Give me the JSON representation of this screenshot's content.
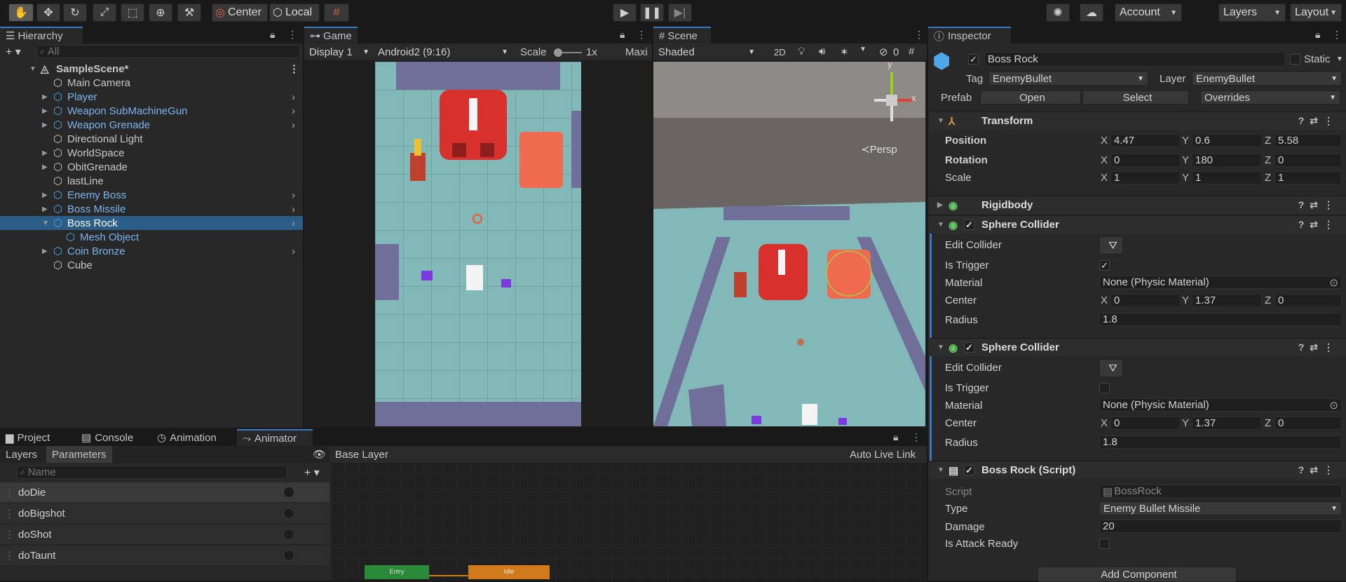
{
  "toolbar": {
    "tools": [
      "hand-tool",
      "move-tool",
      "rotate-tool",
      "scale-tool",
      "rect-tool",
      "transform-tool",
      "custom-tool"
    ],
    "pivot_label": "Center",
    "space_label": "Local",
    "account_label": "Account",
    "layers_label": "Layers",
    "layout_label": "Layout"
  },
  "hierarchy": {
    "tab": "Hierarchy",
    "search_placeholder": "All",
    "scene": "SampleScene*",
    "items": [
      {
        "label": "Main Camera",
        "prefab": false
      },
      {
        "label": "Player",
        "prefab": true
      },
      {
        "label": "Weapon SubMachineGun",
        "prefab": true
      },
      {
        "label": "Weapon Grenade",
        "prefab": true
      },
      {
        "label": "Directional Light",
        "prefab": false
      },
      {
        "label": "WorldSpace",
        "prefab": false
      },
      {
        "label": "ObitGrenade",
        "prefab": false
      },
      {
        "label": "lastLine",
        "prefab": false
      },
      {
        "label": "Enemy Boss",
        "prefab": true
      },
      {
        "label": "Boss Missile",
        "prefab": true
      },
      {
        "label": "Boss Rock",
        "prefab": true
      },
      {
        "label": "Mesh Object",
        "prefab": true
      },
      {
        "label": "Coin Bronze",
        "prefab": true
      },
      {
        "label": "Cube",
        "prefab": false
      }
    ]
  },
  "game": {
    "tab": "Game",
    "display": "Display 1",
    "resolution": "Android2 (9:16)",
    "scale_label": "Scale",
    "scale_value": "1x",
    "maximize": "Maxi"
  },
  "scene_view": {
    "tab": "Scene",
    "shading": "Shaded",
    "mode_2d": "2D",
    "hidden_count": "0",
    "persp": "Persp",
    "gizmo_y": "y",
    "gizmo_x": "x"
  },
  "bottom": {
    "tabs": [
      "Project",
      "Console",
      "Animation",
      "Animator"
    ],
    "subtabs": [
      "Layers",
      "Parameters"
    ],
    "name_placeholder": "Name",
    "base_layer": "Base Layer",
    "auto_live": "Auto Live Link",
    "params": [
      "doDie",
      "doBigshot",
      "doShot",
      "doTaunt"
    ],
    "state_entry": "Entry",
    "state_idle": "Idle"
  },
  "inspector": {
    "tab": "Inspector",
    "name": "Boss Rock",
    "static": "Static",
    "tag_label": "Tag",
    "tag": "EnemyBullet",
    "layer_label": "Layer",
    "layer": "EnemyBullet",
    "prefab_label": "Prefab",
    "open": "Open",
    "select": "Select",
    "overrides": "Overrides",
    "transform": {
      "title": "Transform",
      "position_label": "Position",
      "rotation_label": "Rotation",
      "scale_label": "Scale",
      "position": [
        "4.47",
        "0.6",
        "5.58"
      ],
      "rotation": [
        "0",
        "180",
        "0"
      ],
      "scale": [
        "1",
        "1",
        "1"
      ]
    },
    "rigidbody": "Rigidbody",
    "sphere1": {
      "title": "Sphere Collider",
      "edit": "Edit Collider",
      "trigger_label": "Is Trigger",
      "trigger": true,
      "material_label": "Material",
      "material": "None (Physic Material)",
      "center_label": "Center",
      "center": [
        "0",
        "1.37",
        "0"
      ],
      "radius_label": "Radius",
      "radius": "1.8"
    },
    "sphere2": {
      "title": "Sphere Collider",
      "edit": "Edit Collider",
      "trigger_label": "Is Trigger",
      "trigger": false,
      "material_label": "Material",
      "material": "None (Physic Material)",
      "center_label": "Center",
      "center": [
        "0",
        "1.37",
        "0"
      ],
      "radius_label": "Radius",
      "radius": "1.8"
    },
    "script": {
      "title": "Boss Rock (Script)",
      "script_label": "Script",
      "script": "BossRock",
      "type_label": "Type",
      "type": "Enemy Bullet Missile",
      "damage_label": "Damage",
      "damage": "20",
      "ready_label": "Is Attack Ready"
    },
    "add_component": "Add Component"
  },
  "axes": [
    "X",
    "Y",
    "Z"
  ],
  "colors": {
    "selection": "#2c5d87",
    "accent": "#3a79bb",
    "prefab_text": "#7bb4f0",
    "floor": "#7fb4b4",
    "wall": "#6f6f9a",
    "boss": "#d8302c"
  }
}
